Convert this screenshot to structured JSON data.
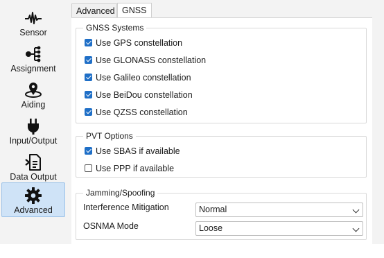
{
  "sidebar": {
    "items": [
      {
        "label": "Sensor",
        "icon": "waveform-icon"
      },
      {
        "label": "Assignment",
        "icon": "tree-nodes-icon"
      },
      {
        "label": "Aiding",
        "icon": "location-pin-icon"
      },
      {
        "label": "Input/Output",
        "icon": "power-plug-icon"
      },
      {
        "label": "Data Output",
        "icon": "document-export-icon"
      },
      {
        "label": "Advanced",
        "icon": "gear-icon",
        "active": true
      }
    ]
  },
  "tabs": [
    {
      "label": "Advanced"
    },
    {
      "label": "GNSS",
      "active": true
    }
  ],
  "gnss_systems": {
    "title": "GNSS Systems",
    "options": [
      {
        "label": "Use GPS constellation",
        "checked": true
      },
      {
        "label": "Use GLONASS constellation",
        "checked": true
      },
      {
        "label": "Use Galileo constellation",
        "checked": true
      },
      {
        "label": "Use BeiDou constellation",
        "checked": true
      },
      {
        "label": "Use QZSS constellation",
        "checked": true
      }
    ]
  },
  "pvt_options": {
    "title": "PVT Options",
    "options": [
      {
        "label": "Use SBAS if available",
        "checked": true
      },
      {
        "label": "Use PPP if available",
        "checked": false
      }
    ]
  },
  "jamming": {
    "title": "Jamming/Spoofing",
    "interference_label": "Interference Mitigation",
    "interference_value": "Normal",
    "osnma_label": "OSNMA Mode",
    "osnma_value": "Loose"
  },
  "colors": {
    "accent": "#1f6fc7",
    "active_nav_bg": "#cfe3f7"
  }
}
